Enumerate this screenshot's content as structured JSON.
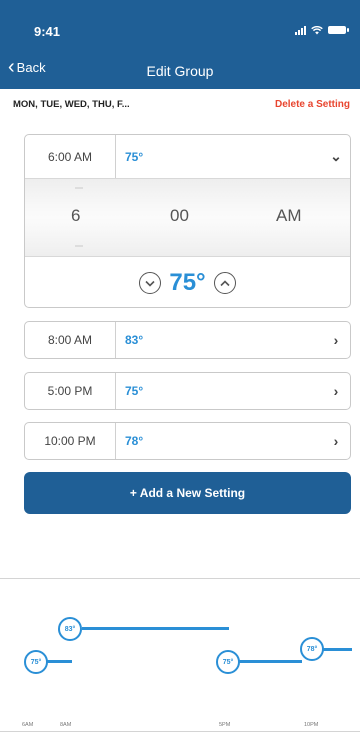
{
  "status": {
    "time": "9:41"
  },
  "nav": {
    "back_label": "Back",
    "title": "Edit Group"
  },
  "days_summary": "MON, TUE, WED, THU, F...",
  "delete_label": "Delete a Setting",
  "expanded_setting": {
    "time": "6:00 AM",
    "temp": "75°",
    "picker": {
      "hour": "6",
      "minute": "00",
      "ampm": "AM"
    },
    "setpoint": "75°"
  },
  "settings": [
    {
      "time": "8:00 AM",
      "temp": "83°"
    },
    {
      "time": "5:00 PM",
      "temp": "75°"
    },
    {
      "time": "10:00 PM",
      "temp": "78°"
    }
  ],
  "add_button_label": "+ Add a New Setting",
  "schedule_graph": {
    "points": [
      {
        "label": "75°",
        "temp": 75
      },
      {
        "label": "83°",
        "temp": 83
      },
      {
        "label": "75°",
        "temp": 75
      },
      {
        "label": "78°",
        "temp": 78
      }
    ],
    "ticks": [
      "6AM",
      "8AM",
      "5PM",
      "10PM"
    ]
  },
  "colors": {
    "header": "#1f5f96",
    "accent": "#2a8fd6",
    "danger": "#e8452f"
  }
}
